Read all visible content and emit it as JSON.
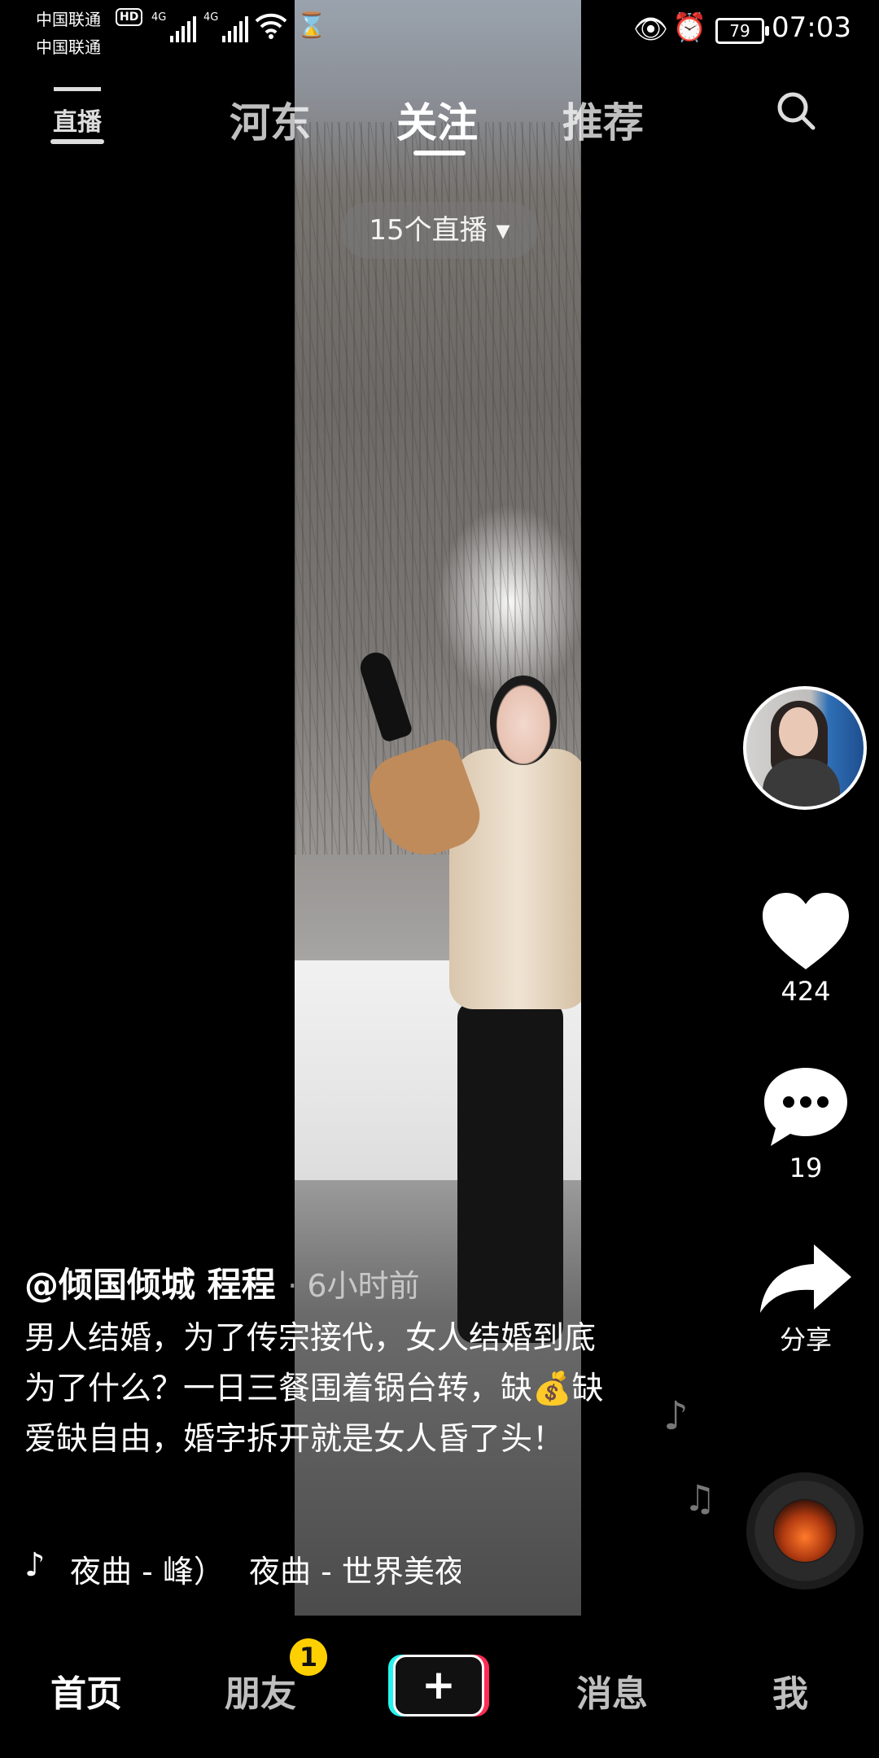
{
  "status_bar": {
    "carrier1": "中国联通",
    "carrier2": "中国联通",
    "hd": "HD",
    "net1": "4G",
    "net2": "4G",
    "battery": "79",
    "time": "07:03"
  },
  "top_nav": {
    "live_label": "直播",
    "tabs": [
      {
        "label": "河东",
        "active": false
      },
      {
        "label": "关注",
        "active": true
      },
      {
        "label": "推荐",
        "active": false
      }
    ]
  },
  "live_pill": "15个直播 ▾",
  "right_rail": {
    "likes": "424",
    "comments": "19",
    "share": "分享"
  },
  "post": {
    "author": "@倾国倾城 程程",
    "time_ago": "· 6小时前",
    "caption": "男人结婚，为了传宗接代，女人结婚到底为了什么？一日三餐围着锅台转，缺💰缺爱缺自由，婚字拆开就是女人昏了头！",
    "music_1": "夜曲 - 峰）",
    "music_2": "夜曲 - 世界美夜曲"
  },
  "bottom_nav": {
    "home": "首页",
    "friends": "朋友",
    "friends_badge": "1",
    "add": "+",
    "messages": "消息",
    "me": "我"
  },
  "colors": {
    "badge": "#ffd000",
    "add_cyan": "#25f4ee",
    "add_red": "#fe2c55"
  }
}
